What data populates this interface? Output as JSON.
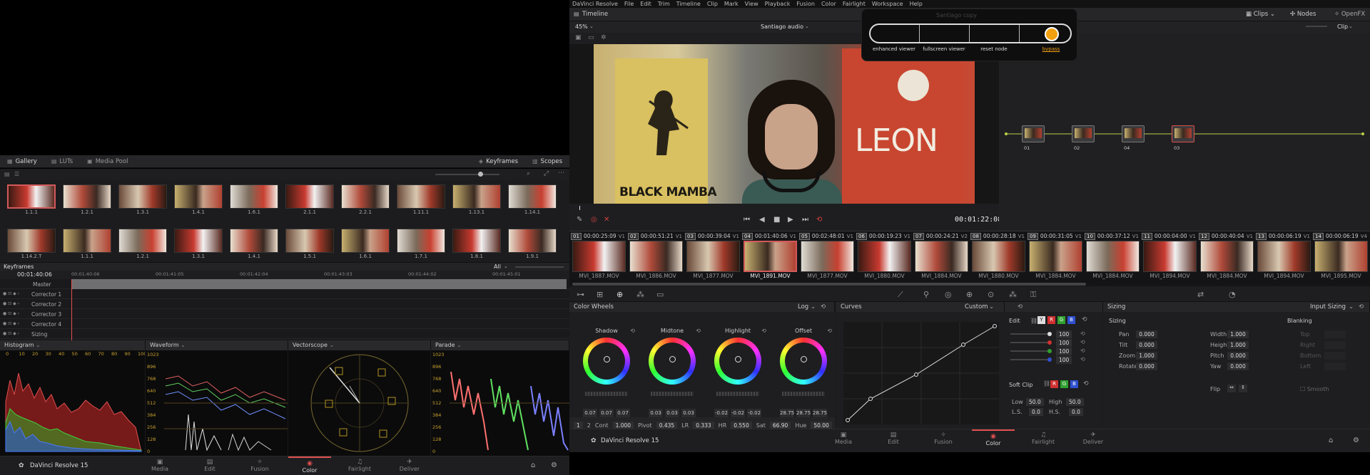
{
  "left": {
    "gallery_tabs": [
      "Gallery",
      "LUTs",
      "Media Pool"
    ],
    "gallery_right_tabs": [
      "Keyframes",
      "Scopes"
    ],
    "stills_row1": [
      "1.1.1",
      "1.2.1",
      "1.3.1",
      "1.4.1",
      "1.6.1",
      "2.1.1",
      "2.2.1",
      "1.11.1",
      "1.13.1",
      "1.14.1"
    ],
    "stills_row2": [
      "1.14.2.T",
      "1.1.1",
      "1.2.1",
      "1.3.1",
      "1.4.1",
      "1.5.1",
      "1.6.1",
      "1.7.1",
      "1.8.1",
      "1.9.1"
    ],
    "keyframes_title": "Keyframes",
    "keyframes_filter": "All",
    "keyframes_timecode": "00:01:40:06",
    "ruler_times": [
      "00:01:40:06",
      "00:01:41:05",
      "00:01:42:04",
      "00:01:43:03",
      "00:01:44:02",
      "00:01:45:01"
    ],
    "tracks": [
      "Master",
      "Corrector 1",
      "Corrector 2",
      "Corrector 3",
      "Corrector 4",
      "Sizing"
    ],
    "scopes": {
      "histogram": "Histogram",
      "waveform": "Waveform",
      "vectorscope": "Vectorscope",
      "parade": "Parade",
      "histogram_ticks": [
        "0",
        "10",
        "20",
        "30",
        "40",
        "50",
        "60",
        "70",
        "80",
        "90",
        "100"
      ],
      "scale": [
        "1023",
        "896",
        "768",
        "640",
        "512",
        "384",
        "256",
        "128",
        "0"
      ]
    },
    "app_name": "DaVinci Resolve 15",
    "pages": [
      "Media",
      "Edit",
      "Fusion",
      "Color",
      "Fairlight",
      "Deliver"
    ],
    "active_page": "Color"
  },
  "right": {
    "menu": [
      "DaVinci Resolve",
      "File",
      "Edit",
      "Trim",
      "Timeline",
      "Clip",
      "Mark",
      "View",
      "Playback",
      "Fusion",
      "Color",
      "Fairlight",
      "Workspace",
      "Help"
    ],
    "timeline_tab": "Timeline",
    "clips_tab": "Clips",
    "nodes_tab": "Nodes",
    "openfx_tab": "OpenFX",
    "zoom": "45%",
    "timeline_name": "Santiago audio",
    "node_mode": "Clip",
    "popup_title": "Santiago copy",
    "popup_labels": [
      "enhanced viewer",
      "fullscreen viewer",
      "reset node",
      "bypass"
    ],
    "poster_left": "BLACK MAMBA",
    "poster_right": "LEON",
    "viewer_timecode": "00:01:22:08",
    "nodes": [
      "01",
      "02",
      "04",
      "03"
    ],
    "clips": [
      {
        "num": "01",
        "tc": "00:00:25:09",
        "track": "V1",
        "name": "MVI_1887.MOV"
      },
      {
        "num": "02",
        "tc": "00:00:51:21",
        "track": "V1",
        "name": "MVI_1886.MOV"
      },
      {
        "num": "03",
        "tc": "00:00:39:04",
        "track": "V1",
        "name": "MVI_1877.MOV"
      },
      {
        "num": "04",
        "tc": "00:01:40:06",
        "track": "V1",
        "name": "MVI_1891.MOV"
      },
      {
        "num": "05",
        "tc": "00:02:48:01",
        "track": "V1",
        "name": "MVI_1877.MOV"
      },
      {
        "num": "06",
        "tc": "00:00:19:23",
        "track": "V1",
        "name": "MVI_1880.MOV"
      },
      {
        "num": "07",
        "tc": "00:00:24:21",
        "track": "V2",
        "name": "MVI_1884.MOV"
      },
      {
        "num": "08",
        "tc": "00:00:28:18",
        "track": "V1",
        "name": "MVI_1880.MOV"
      },
      {
        "num": "09",
        "tc": "00:00:31:05",
        "track": "V1",
        "name": "MVI_1884.MOV"
      },
      {
        "num": "10",
        "tc": "00:00:37:12",
        "track": "V1",
        "name": "MVI_1884.MOV"
      },
      {
        "num": "11",
        "tc": "00:00:04:00",
        "track": "V1",
        "name": "MVI_1894.MOV"
      },
      {
        "num": "12",
        "tc": "00:00:40:04",
        "track": "V1",
        "name": "MVI_1884.MOV"
      },
      {
        "num": "13",
        "tc": "00:00:06:19",
        "track": "V1",
        "name": "MVI_1894.MOV"
      },
      {
        "num": "14",
        "tc": "00:00:06:19",
        "track": "V4",
        "name": "MVI_1895.MOV"
      }
    ],
    "color_wheels": {
      "title": "Color Wheels",
      "mode": "Log",
      "wheels": [
        {
          "name": "Shadow",
          "values": [
            "0.07",
            "0.07",
            "0.07"
          ]
        },
        {
          "name": "Midtone",
          "values": [
            "0.03",
            "0.03",
            "0.03"
          ]
        },
        {
          "name": "Highlight",
          "values": [
            "-0.02",
            "-0.02",
            "-0.02"
          ]
        },
        {
          "name": "Offset",
          "values": [
            "28.75",
            "28.75",
            "28.75"
          ]
        }
      ],
      "rgb": [
        "R",
        "G",
        "B"
      ],
      "bottom": {
        "page1": "1",
        "page2": "2",
        "cont_label": "Cont",
        "cont": "1.000",
        "pivot_label": "Pivot",
        "pivot": "0.435",
        "lr_label": "LR",
        "lr": "0.333",
        "hr_label": "HR",
        "hr": "0.550",
        "sat_label": "Sat",
        "sat": "66.90",
        "hue_label": "Hue",
        "hue": "50.00"
      }
    },
    "curves": {
      "title": "Curves",
      "mode": "Custom",
      "edit": "Edit",
      "channel_values": [
        "100",
        "100",
        "100",
        "100"
      ],
      "soft_clip": "Soft Clip",
      "low_label": "Low",
      "low": "50.0",
      "high_label": "High",
      "high": "50.0",
      "ls_label": "L.S.",
      "ls": "0.0",
      "hs_label": "H.S.",
      "hs": "0.0",
      "ymode": "Y",
      "rlabel": "R",
      "glabel": "G",
      "blabel": "B"
    },
    "sizing": {
      "title": "Sizing",
      "mode": "Input Sizing",
      "left_title": "Sizing",
      "left_fields": [
        {
          "label": "Pan",
          "value": "0.000"
        },
        {
          "label": "Tilt",
          "value": "0.000"
        },
        {
          "label": "Zoom",
          "value": "1.000"
        },
        {
          "label": "Rotate",
          "value": "0.000"
        }
      ],
      "mid_fields": [
        {
          "label": "Width",
          "value": "1.000"
        },
        {
          "label": "Height",
          "value": "1.000"
        },
        {
          "label": "Pitch",
          "value": "0.000"
        },
        {
          "label": "Yaw",
          "value": "0.000"
        }
      ],
      "flip": "Flip",
      "blanking": "Blanking",
      "blanking_fields": [
        "Top",
        "Right",
        "Bottom",
        "Left"
      ],
      "smooth": "Smooth"
    },
    "app_name": "DaVinci Resolve 15",
    "pages": [
      "Media",
      "Edit",
      "Fusion",
      "Color",
      "Fairlight",
      "Deliver"
    ],
    "active_page": "Color"
  }
}
